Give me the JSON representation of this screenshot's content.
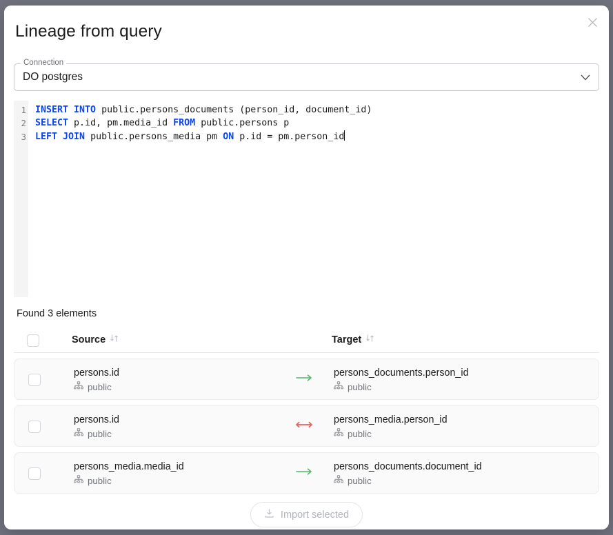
{
  "dialog": {
    "title": "Lineage from query",
    "close_icon": "close-icon"
  },
  "connection": {
    "label": "Connection",
    "value": "DO postgres",
    "chevron_icon": "chevron-down-icon"
  },
  "editor": {
    "line_numbers": [
      "1",
      "2",
      "3"
    ],
    "lines": [
      [
        {
          "t": "INSERT INTO",
          "kw": true
        },
        {
          "t": " public.persons_documents (person_id, document_id)",
          "kw": false
        }
      ],
      [
        {
          "t": "SELECT",
          "kw": true
        },
        {
          "t": " p.id, pm.media_id ",
          "kw": false
        },
        {
          "t": "FROM",
          "kw": true
        },
        {
          "t": " public.persons p",
          "kw": false
        }
      ],
      [
        {
          "t": "LEFT JOIN",
          "kw": true
        },
        {
          "t": " public.persons_media pm ",
          "kw": false
        },
        {
          "t": "ON",
          "kw": true
        },
        {
          "t": " p.id = pm.person_id",
          "kw": false
        }
      ]
    ],
    "raw_sql": "INSERT INTO public.persons_documents (person_id, document_id)\nSELECT p.id, pm.media_id FROM public.persons p\nLEFT JOIN public.persons_media pm ON p.id = pm.person_id"
  },
  "results": {
    "found_label": "Found 3 elements",
    "columns": [
      {
        "key": "source",
        "label": "Source",
        "sort_icon": "sort-updown-icon"
      },
      {
        "key": "target",
        "label": "Target",
        "sort_icon": "sort-updown-icon"
      }
    ],
    "select_all_checked": false,
    "rows": [
      {
        "checked": false,
        "source": {
          "name": "persons.id",
          "schema": "public",
          "schema_icon": "schema-icon"
        },
        "direction": "one-way",
        "arrow_icon": "arrow-right-icon",
        "arrow_color": "#55b36a",
        "target": {
          "name": "persons_documents.person_id",
          "schema": "public",
          "schema_icon": "schema-icon"
        }
      },
      {
        "checked": false,
        "source": {
          "name": "persons.id",
          "schema": "public",
          "schema_icon": "schema-icon"
        },
        "direction": "two-way",
        "arrow_icon": "arrow-left-right-icon",
        "arrow_color": "#e8625c",
        "target": {
          "name": "persons_media.person_id",
          "schema": "public",
          "schema_icon": "schema-icon"
        }
      },
      {
        "checked": false,
        "source": {
          "name": "persons_media.media_id",
          "schema": "public",
          "schema_icon": "schema-icon"
        },
        "direction": "one-way",
        "arrow_icon": "arrow-right-icon",
        "arrow_color": "#55b36a",
        "target": {
          "name": "persons_documents.document_id",
          "schema": "public",
          "schema_icon": "schema-icon"
        }
      }
    ]
  },
  "footer": {
    "import_label": "Import selected",
    "import_icon": "download-icon",
    "import_disabled": true
  },
  "colors": {
    "keyword": "#0b44f0",
    "arrow_forward": "#55b36a",
    "arrow_bidirectional": "#e8625c",
    "backdrop": "#70737f",
    "dialog_bg": "#ffffff",
    "row_bg": "#fafafa"
  }
}
